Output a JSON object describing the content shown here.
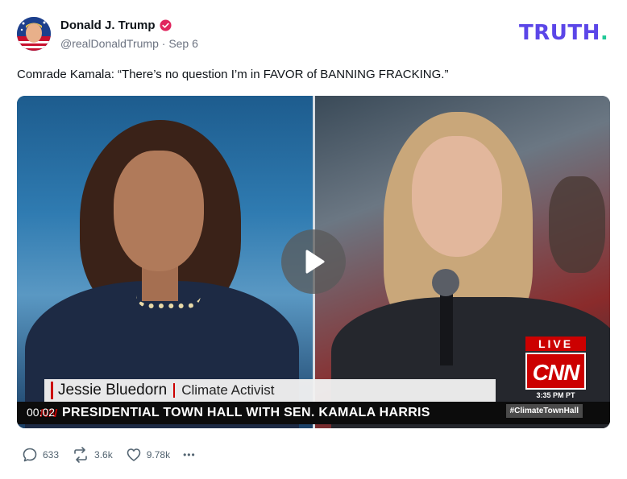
{
  "author": {
    "display_name": "Donald J. Trump",
    "handle": "@realDonaldTrump",
    "separator": "·",
    "date": "Sep 6",
    "verified_icon": "verified-badge-icon",
    "verified_color": "#e0245e"
  },
  "brand": {
    "logo_main": "TRUTH",
    "logo_dot": ".",
    "logo_color": "#5b46e8",
    "dot_color": "#20c997"
  },
  "post": {
    "text": "Comrade Kamala: “There’s no question I’m in FAVOR of BANNING FRACKING.”"
  },
  "media": {
    "play_icon": "play-icon",
    "video_time": "00:02",
    "lower_third_name": "Jessie Bluedorn",
    "lower_third_title": "Climate Activist",
    "ticker_logo": "NN",
    "ticker_text": "PRESIDENTIAL TOWN HALL WITH SEN. KAMALA HARRIS",
    "live_label": "LIVE",
    "network_logo": "CNN",
    "broadcast_time": "3:35 PM PT",
    "hashtag": "#ClimateTownHall"
  },
  "actions": {
    "replies": "633",
    "retruths": "3.6k",
    "likes": "9.78k",
    "more": "•••"
  }
}
